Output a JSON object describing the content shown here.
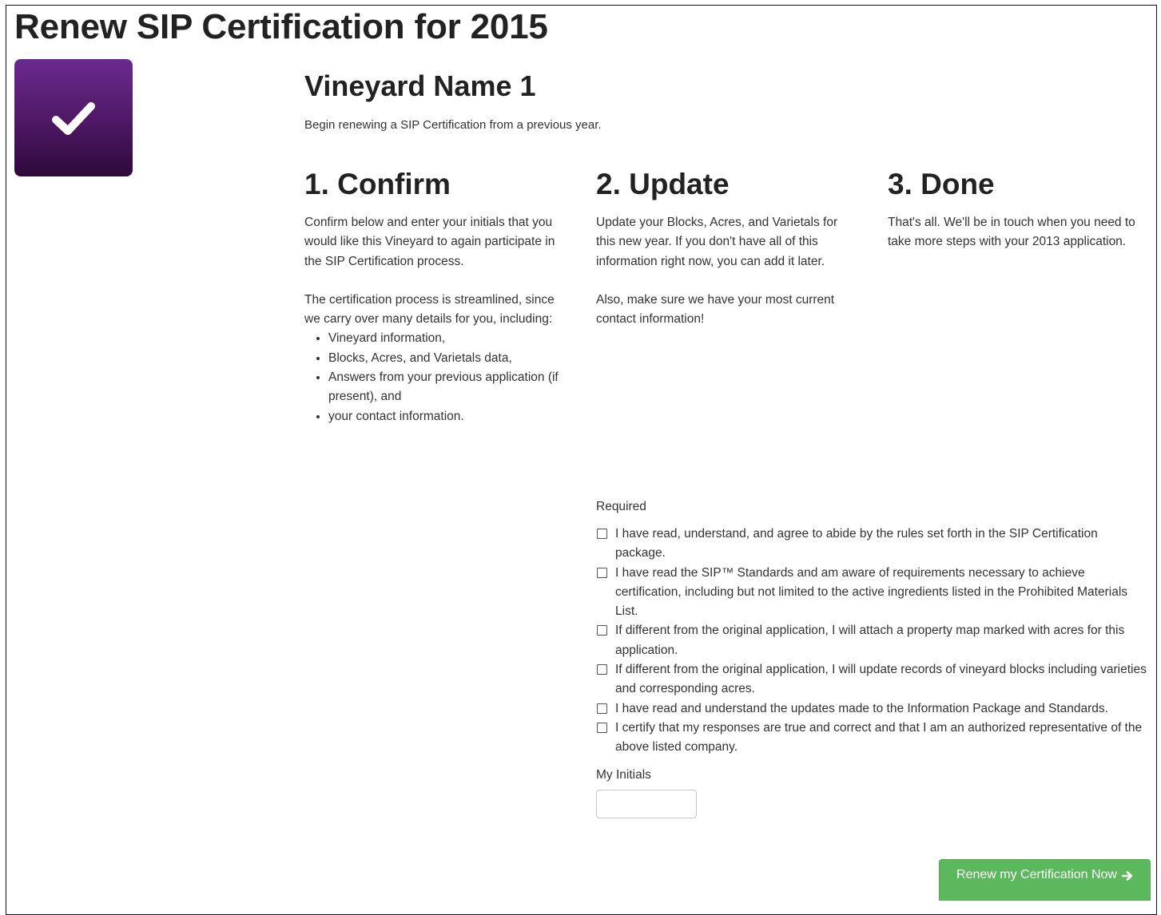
{
  "page": {
    "title": "Renew SIP Certification for 2015"
  },
  "logo": {
    "icon": "checkmark-icon",
    "gradient_top": "#6b2a8f",
    "gradient_bottom": "#2d0a3b"
  },
  "vineyard": {
    "name": "Vineyard Name 1",
    "intro": "Begin renewing a SIP Certification from a previous year."
  },
  "steps": [
    {
      "heading": "1. Confirm",
      "paragraphs": [
        "Confirm below and enter your initials that you would like this Vineyard to again participate in the SIP Certification process.",
        "The certification process is streamlined, since we carry over many details for you, including:"
      ],
      "list": [
        "Vineyard information,",
        "Blocks, Acres, and Varietals data,",
        "Answers from your previous application (if present), and",
        "your contact information."
      ]
    },
    {
      "heading": "2. Update",
      "paragraphs": [
        "Update your Blocks, Acres, and Varietals for this new year. If you don't have all of this information right now, you can add it later.",
        "Also, make sure we have your most current contact information!"
      ]
    },
    {
      "heading": "3. Done",
      "paragraphs": [
        "That's all. We'll be in touch when you need to take more steps with your 2013 application."
      ]
    }
  ],
  "form": {
    "required_label": "Required",
    "checkboxes": [
      "I have read, understand, and agree to abide by the rules set forth in the SIP Certification package.",
      "I have read the SIP™ Standards and am aware of requirements necessary to achieve certification, including but not limited to the active ingredients listed in the Prohibited Materials List.",
      "If different from the original application, I will attach a property map marked with acres for this application.",
      "If different from the original application, I will update records of vineyard blocks including varieties and corresponding acres.",
      "I have read and understand the updates made to the Information Package and Standards.",
      "I certify that my responses are true and correct and that I am an authorized representative of the above listed company."
    ],
    "initials_label": "My Initials",
    "initials_value": "",
    "submit_label": "Renew my Certification Now",
    "submit_icon": "arrow-right-icon",
    "submit_color": "#5cb85c"
  }
}
